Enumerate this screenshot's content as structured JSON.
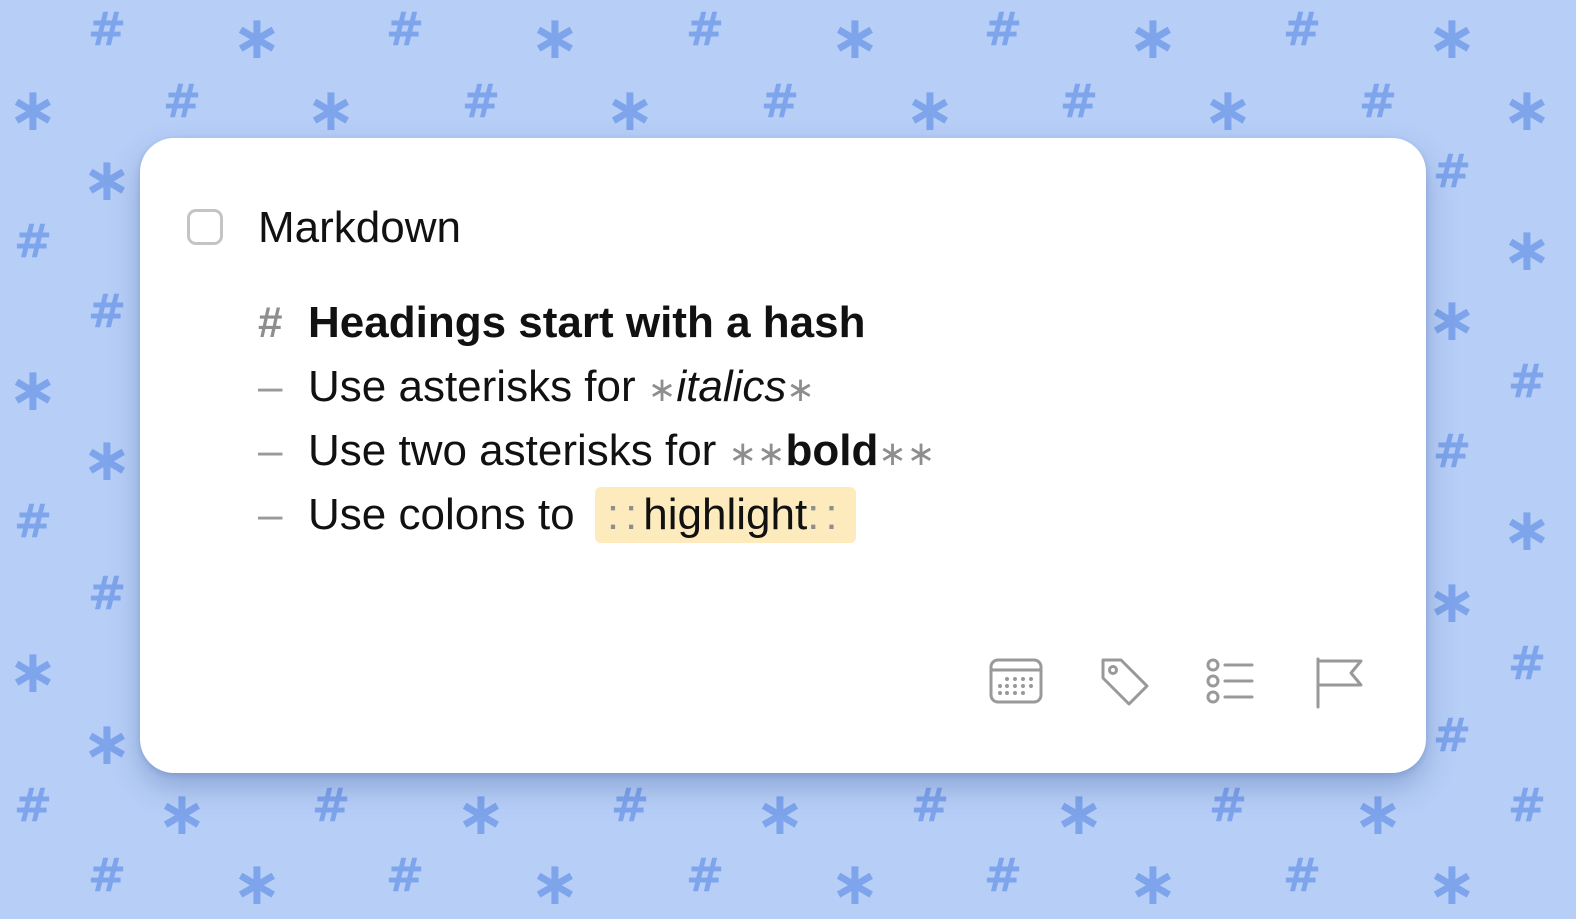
{
  "todo": {
    "title": "Markdown",
    "checked": false,
    "notes": {
      "heading_marker": "#",
      "heading": "Headings start with a hash",
      "item_marker": "–",
      "items": [
        {
          "prefix": "Use asterisks for ",
          "open": "∗",
          "text": "italics",
          "close": "∗"
        },
        {
          "prefix": "Use two asterisks for ",
          "open": "∗∗",
          "text": "bold",
          "close": "∗∗"
        },
        {
          "prefix": "Use colons to ",
          "open": "::",
          "text": "highlight",
          "close": "::"
        }
      ]
    }
  },
  "toolbar": {
    "icons": [
      "calendar-icon",
      "tag-icon",
      "checklist-icon",
      "flag-icon"
    ]
  },
  "background": {
    "symbols": [
      "#",
      "∗"
    ]
  },
  "colors": {
    "background": "#b7cff7",
    "pattern": "#7ea4ec",
    "card": "#ffffff",
    "highlight": "#fdebbd",
    "muted": "#8e8e8e"
  }
}
